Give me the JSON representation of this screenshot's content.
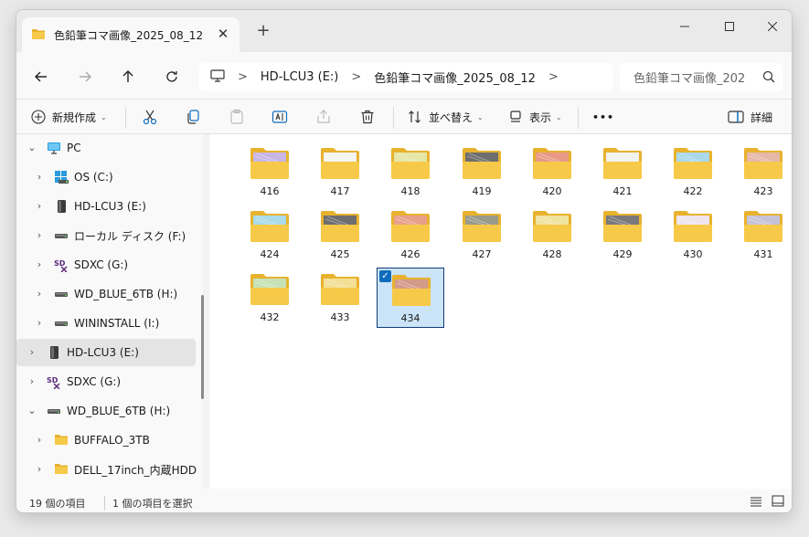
{
  "tab": {
    "title": "色鉛筆コマ画像_2025_08_12",
    "close": "✕",
    "new_tab": "+"
  },
  "window_controls": {
    "minimize": "—",
    "maximize": "☐",
    "close": "✕"
  },
  "nav": {
    "back": "←",
    "forward": "→",
    "up": "↑",
    "refresh": "⟳"
  },
  "address": {
    "sep": ">",
    "crumbs": [
      "HD-LCU3 (E:)",
      "色鉛筆コマ画像_2025_08_12"
    ]
  },
  "search": {
    "placeholder": "色鉛筆コマ画像_202"
  },
  "toolbar": {
    "new_label": "新規作成",
    "sort_label": "並べ替え",
    "view_label": "表示",
    "more_label": "•••",
    "details_label": "詳細",
    "caret": "⌄"
  },
  "sidebar": {
    "items": [
      {
        "label": "PC",
        "icon": "pc-icon",
        "expanded": true
      },
      {
        "label": "OS (C:)",
        "icon": "windows-drive-icon"
      },
      {
        "label": "HD-LCU3 (E:)",
        "icon": "external-drive-icon"
      },
      {
        "label": "ローカル ディスク (F:)",
        "icon": "drive-icon"
      },
      {
        "label": "SDXC (G:)",
        "icon": "sd-card-icon"
      },
      {
        "label": "WD_BLUE_6TB (H:)",
        "icon": "drive-icon"
      },
      {
        "label": "WININSTALL (I:)",
        "icon": "drive-icon"
      },
      {
        "label": "HD-LCU3 (E:)",
        "icon": "external-drive-icon",
        "selected": true
      },
      {
        "label": "SDXC (G:)",
        "icon": "sd-card-icon"
      },
      {
        "label": "WD_BLUE_6TB (H:)",
        "icon": "drive-icon",
        "expanded": true
      },
      {
        "label": "BUFFALO_3TB",
        "icon": "folder-icon"
      },
      {
        "label": "DELL_17inch_内蔵HDD",
        "icon": "folder-icon"
      }
    ]
  },
  "files": [
    {
      "name": "416",
      "tint": "#c8b6e6"
    },
    {
      "name": "417",
      "tint": "#f4f4f0"
    },
    {
      "name": "418",
      "tint": "#e6e6a6"
    },
    {
      "name": "419",
      "tint": "#6e6e6e"
    },
    {
      "name": "420",
      "tint": "#e89a86"
    },
    {
      "name": "421",
      "tint": "#f2f2ee"
    },
    {
      "name": "422",
      "tint": "#a9d9ea"
    },
    {
      "name": "423",
      "tint": "#e6b8a8"
    },
    {
      "name": "424",
      "tint": "#a9dbe8"
    },
    {
      "name": "425",
      "tint": "#6e6e6e"
    },
    {
      "name": "426",
      "tint": "#e8a08a"
    },
    {
      "name": "427",
      "tint": "#9a9a8a"
    },
    {
      "name": "428",
      "tint": "#f0e3a0"
    },
    {
      "name": "429",
      "tint": "#7a7a7a"
    },
    {
      "name": "430",
      "tint": "#efe4ee"
    },
    {
      "name": "431",
      "tint": "#c6c3d8"
    },
    {
      "name": "432",
      "tint": "#c6e2b6"
    },
    {
      "name": "433",
      "tint": "#f3df96"
    },
    {
      "name": "434",
      "tint": "#d39a8a",
      "selected": true
    }
  ],
  "status": {
    "count": "19 個の項目",
    "selected": "1 個の項目を選択"
  },
  "colors": {
    "accent": "#0f6cbd",
    "folder": "#f7c948",
    "folder_dark": "#e8b22e"
  }
}
